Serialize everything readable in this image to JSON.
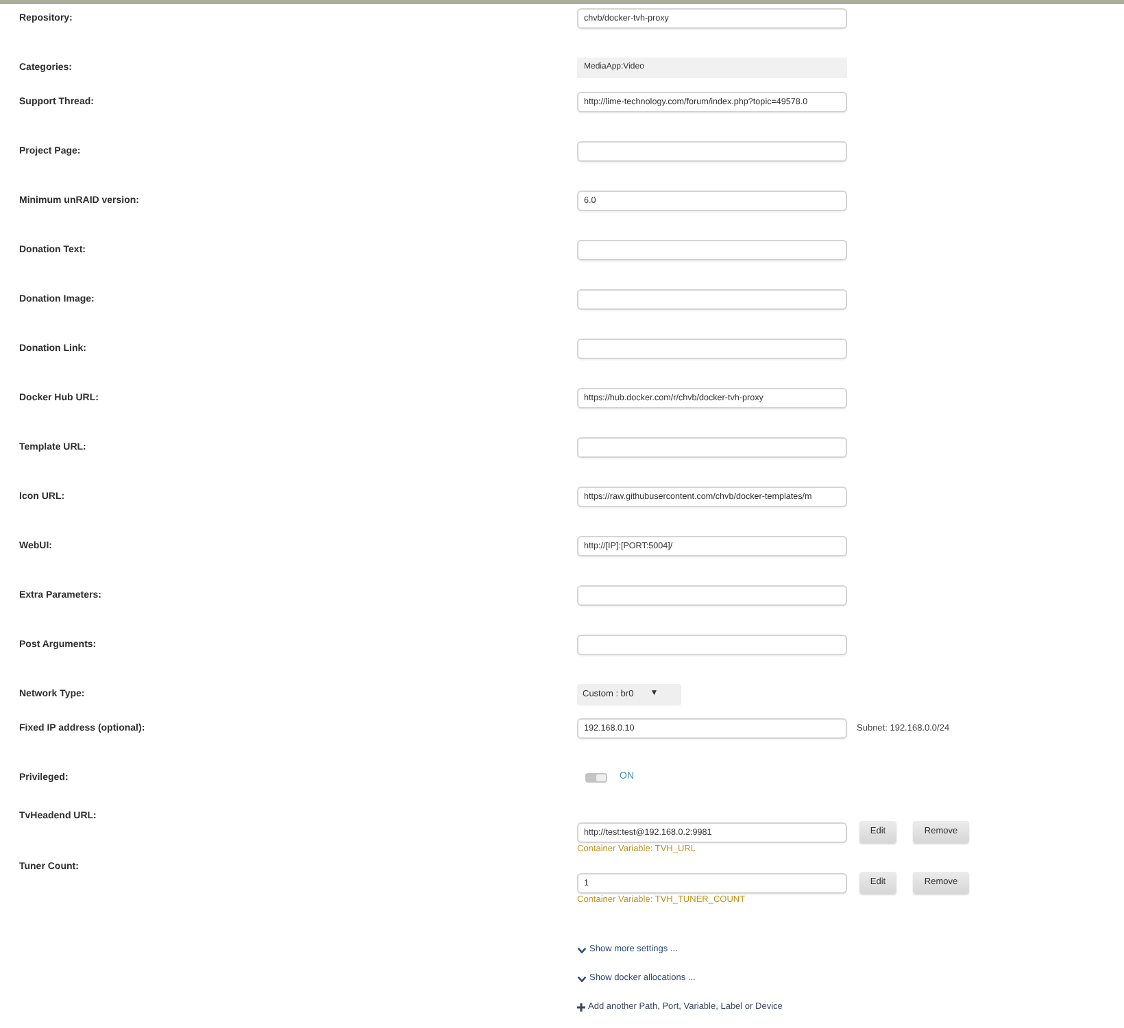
{
  "fields": [
    {
      "kind": "text",
      "label": "Repository:",
      "value": "chvb/docker-tvh-proxy"
    },
    {
      "kind": "static",
      "label": "Categories:",
      "value": "MediaApp:Video"
    },
    {
      "kind": "text",
      "label": "Support Thread:",
      "value": "http://lime-technology.com/forum/index.php?topic=49578.0"
    },
    {
      "kind": "text",
      "label": "Project Page:"
    },
    {
      "kind": "text",
      "label": "Minimum unRAID version:",
      "value": "6.0"
    },
    {
      "kind": "text",
      "label": "Donation Text:"
    },
    {
      "kind": "text",
      "label": "Donation Image:"
    },
    {
      "kind": "text",
      "label": "Donation Link:"
    },
    {
      "kind": "text",
      "label": "Docker Hub URL:",
      "value": "https://hub.docker.com/r/chvb/docker-tvh-proxy"
    },
    {
      "kind": "text",
      "label": "Template URL:"
    },
    {
      "kind": "text",
      "label": "Icon URL:",
      "value": "https://raw.githubusercontent.com/chvb/docker-templates/m"
    },
    {
      "kind": "text",
      "label": "WebUI:",
      "value": "http://[IP]:[PORT:5004]/"
    },
    {
      "kind": "text",
      "label": "Extra Parameters:"
    },
    {
      "kind": "text",
      "label": "Post Arguments:"
    },
    {
      "kind": "select",
      "label": "Network Type:",
      "value": "Custom : br0",
      "caret": "▼"
    },
    {
      "kind": "text",
      "label": "Fixed IP address (optional):",
      "value": "192.168.0.10",
      "note": "Subnet: 192.168.0.0/24"
    },
    {
      "kind": "switch",
      "label": "Privileged:",
      "on": true,
      "state_text": "ON"
    }
  ],
  "variables": [
    {
      "label": "TvHeadend URL:",
      "value": "http://test:test@192.168.0.2:9981",
      "buttons": [
        "Edit",
        "Remove"
      ],
      "hint": "Container Variable: TVH_URL"
    },
    {
      "label": "Tuner Count:",
      "value": "1",
      "buttons": [
        "Edit",
        "Remove"
      ],
      "hint": "Container Variable: TVH_TUNER_COUNT"
    }
  ],
  "links": [
    {
      "kind": "expand",
      "text": "Show more settings ..."
    },
    {
      "kind": "expand",
      "text": "Show docker allocations ..."
    },
    {
      "kind": "add",
      "text": "Add another Path, Port, Variable, Label or Device"
    }
  ]
}
